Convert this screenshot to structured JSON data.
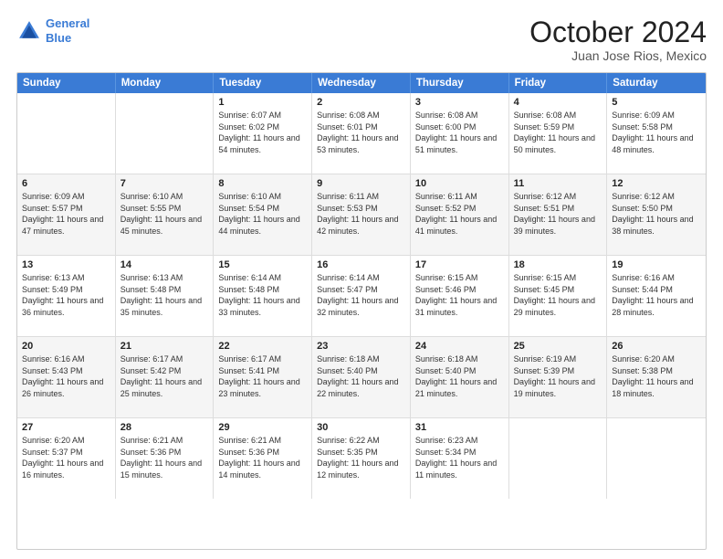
{
  "header": {
    "logo_line1": "General",
    "logo_line2": "Blue",
    "title": "October 2024",
    "subtitle": "Juan Jose Rios, Mexico"
  },
  "calendar": {
    "weekdays": [
      "Sunday",
      "Monday",
      "Tuesday",
      "Wednesday",
      "Thursday",
      "Friday",
      "Saturday"
    ],
    "rows": [
      [
        {
          "day": "",
          "text": ""
        },
        {
          "day": "",
          "text": ""
        },
        {
          "day": "1",
          "text": "Sunrise: 6:07 AM\nSunset: 6:02 PM\nDaylight: 11 hours and 54 minutes."
        },
        {
          "day": "2",
          "text": "Sunrise: 6:08 AM\nSunset: 6:01 PM\nDaylight: 11 hours and 53 minutes."
        },
        {
          "day": "3",
          "text": "Sunrise: 6:08 AM\nSunset: 6:00 PM\nDaylight: 11 hours and 51 minutes."
        },
        {
          "day": "4",
          "text": "Sunrise: 6:08 AM\nSunset: 5:59 PM\nDaylight: 11 hours and 50 minutes."
        },
        {
          "day": "5",
          "text": "Sunrise: 6:09 AM\nSunset: 5:58 PM\nDaylight: 11 hours and 48 minutes."
        }
      ],
      [
        {
          "day": "6",
          "text": "Sunrise: 6:09 AM\nSunset: 5:57 PM\nDaylight: 11 hours and 47 minutes."
        },
        {
          "day": "7",
          "text": "Sunrise: 6:10 AM\nSunset: 5:55 PM\nDaylight: 11 hours and 45 minutes."
        },
        {
          "day": "8",
          "text": "Sunrise: 6:10 AM\nSunset: 5:54 PM\nDaylight: 11 hours and 44 minutes."
        },
        {
          "day": "9",
          "text": "Sunrise: 6:11 AM\nSunset: 5:53 PM\nDaylight: 11 hours and 42 minutes."
        },
        {
          "day": "10",
          "text": "Sunrise: 6:11 AM\nSunset: 5:52 PM\nDaylight: 11 hours and 41 minutes."
        },
        {
          "day": "11",
          "text": "Sunrise: 6:12 AM\nSunset: 5:51 PM\nDaylight: 11 hours and 39 minutes."
        },
        {
          "day": "12",
          "text": "Sunrise: 6:12 AM\nSunset: 5:50 PM\nDaylight: 11 hours and 38 minutes."
        }
      ],
      [
        {
          "day": "13",
          "text": "Sunrise: 6:13 AM\nSunset: 5:49 PM\nDaylight: 11 hours and 36 minutes."
        },
        {
          "day": "14",
          "text": "Sunrise: 6:13 AM\nSunset: 5:48 PM\nDaylight: 11 hours and 35 minutes."
        },
        {
          "day": "15",
          "text": "Sunrise: 6:14 AM\nSunset: 5:48 PM\nDaylight: 11 hours and 33 minutes."
        },
        {
          "day": "16",
          "text": "Sunrise: 6:14 AM\nSunset: 5:47 PM\nDaylight: 11 hours and 32 minutes."
        },
        {
          "day": "17",
          "text": "Sunrise: 6:15 AM\nSunset: 5:46 PM\nDaylight: 11 hours and 31 minutes."
        },
        {
          "day": "18",
          "text": "Sunrise: 6:15 AM\nSunset: 5:45 PM\nDaylight: 11 hours and 29 minutes."
        },
        {
          "day": "19",
          "text": "Sunrise: 6:16 AM\nSunset: 5:44 PM\nDaylight: 11 hours and 28 minutes."
        }
      ],
      [
        {
          "day": "20",
          "text": "Sunrise: 6:16 AM\nSunset: 5:43 PM\nDaylight: 11 hours and 26 minutes."
        },
        {
          "day": "21",
          "text": "Sunrise: 6:17 AM\nSunset: 5:42 PM\nDaylight: 11 hours and 25 minutes."
        },
        {
          "day": "22",
          "text": "Sunrise: 6:17 AM\nSunset: 5:41 PM\nDaylight: 11 hours and 23 minutes."
        },
        {
          "day": "23",
          "text": "Sunrise: 6:18 AM\nSunset: 5:40 PM\nDaylight: 11 hours and 22 minutes."
        },
        {
          "day": "24",
          "text": "Sunrise: 6:18 AM\nSunset: 5:40 PM\nDaylight: 11 hours and 21 minutes."
        },
        {
          "day": "25",
          "text": "Sunrise: 6:19 AM\nSunset: 5:39 PM\nDaylight: 11 hours and 19 minutes."
        },
        {
          "day": "26",
          "text": "Sunrise: 6:20 AM\nSunset: 5:38 PM\nDaylight: 11 hours and 18 minutes."
        }
      ],
      [
        {
          "day": "27",
          "text": "Sunrise: 6:20 AM\nSunset: 5:37 PM\nDaylight: 11 hours and 16 minutes."
        },
        {
          "day": "28",
          "text": "Sunrise: 6:21 AM\nSunset: 5:36 PM\nDaylight: 11 hours and 15 minutes."
        },
        {
          "day": "29",
          "text": "Sunrise: 6:21 AM\nSunset: 5:36 PM\nDaylight: 11 hours and 14 minutes."
        },
        {
          "day": "30",
          "text": "Sunrise: 6:22 AM\nSunset: 5:35 PM\nDaylight: 11 hours and 12 minutes."
        },
        {
          "day": "31",
          "text": "Sunrise: 6:23 AM\nSunset: 5:34 PM\nDaylight: 11 hours and 11 minutes."
        },
        {
          "day": "",
          "text": ""
        },
        {
          "day": "",
          "text": ""
        }
      ]
    ]
  }
}
